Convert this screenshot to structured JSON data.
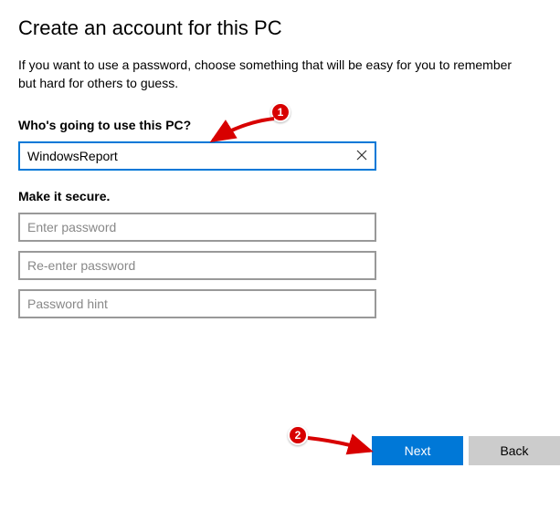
{
  "title": "Create an account for this PC",
  "description": "If you want to use a password, choose something that will be easy for you to remember but hard for others to guess.",
  "section_user": {
    "label": "Who's going to use this PC?",
    "username_value": "WindowsReport"
  },
  "section_secure": {
    "label": "Make it secure.",
    "password_placeholder": "Enter password",
    "reenter_placeholder": "Re-enter password",
    "hint_placeholder": "Password hint"
  },
  "buttons": {
    "next": "Next",
    "back": "Back"
  },
  "annotations": {
    "badge1": "1",
    "badge2": "2"
  }
}
